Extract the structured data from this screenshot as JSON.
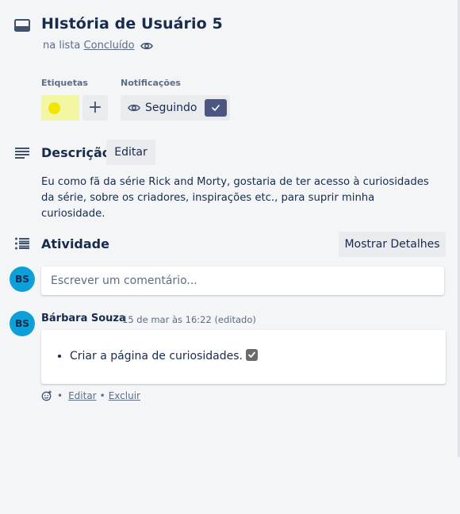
{
  "card": {
    "title": "HIstória de Usuário 5",
    "in_list_prefix": "na lista",
    "list_name": "Concluído"
  },
  "labels": {
    "title": "Etiquetas",
    "items": [
      {
        "color": "#f2e500"
      }
    ],
    "add_label": "+"
  },
  "notifications": {
    "title": "Notificações",
    "follow_label": "Seguindo"
  },
  "description": {
    "title": "Descrição",
    "edit_label": "Editar",
    "text": "Eu como fã da série Rick and Morty, gostaria de ter acesso à curiosidades da série, sobre os criadores, inspirações etc., para suprir minha curiosidade."
  },
  "activity": {
    "title": "Atividade",
    "details_button": "Mostrar Detalhes",
    "comment_placeholder": "Escrever um comentário...",
    "current_user_initials": "BS",
    "entries": [
      {
        "author": "Bárbara Souza",
        "initials": "BS",
        "timestamp": "15 de mar às 16:22 (editado)",
        "bullet": "Criar a página de curiosidades.",
        "edit": "Editar",
        "delete": "Excluir",
        "separator": "•"
      }
    ]
  },
  "colors": {
    "avatar": "#0d9fd8",
    "label_chip_bg": "#f3f6a3",
    "follow_check_bg": "#4c5681"
  },
  "icons": [
    "card-icon",
    "eye-icon",
    "description-icon",
    "activity-icon",
    "check-icon",
    "add-reaction-icon"
  ]
}
